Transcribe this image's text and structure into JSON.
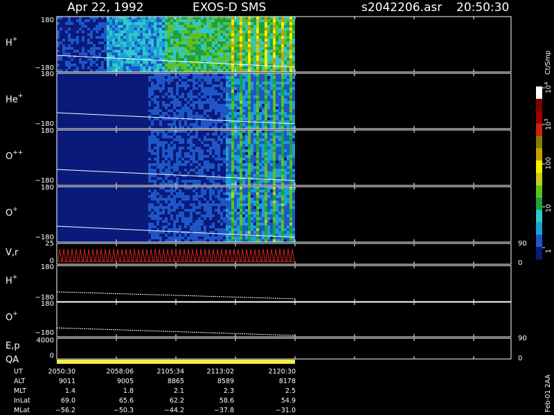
{
  "header": {
    "date": "Apr 22, 1992",
    "instrument": "EXOS-D SMS",
    "file": "s2042206.asr",
    "time": "20:50:30"
  },
  "chart_data": {
    "type": "heatmap",
    "panels": [
      {
        "label": "H",
        "sup": "+",
        "y_top": "180",
        "y_bottom": "−180"
      },
      {
        "label": "He",
        "sup": "+",
        "y_top": "180",
        "y_bottom": "−180"
      },
      {
        "label": "O",
        "sup": "++",
        "y_top": "180",
        "y_bottom": "−180"
      },
      {
        "label": "O",
        "sup": "+",
        "y_top": "180",
        "y_bottom": "−180"
      },
      {
        "label": "V,r",
        "sup": "",
        "y_top": "25",
        "y_bottom": "0",
        "right_top": "90",
        "right_bottom": "0"
      },
      {
        "label": "H",
        "sup": "+",
        "y_top": "180",
        "y_bottom": "−180"
      },
      {
        "label": "O",
        "sup": "+",
        "y_top": "180",
        "y_bottom": "−180"
      },
      {
        "label": "E,p",
        "sup": "",
        "y_top": "4000",
        "y_bottom": "0",
        "right_top": "90",
        "right_bottom": "0"
      },
      {
        "label": "QA",
        "sup": "",
        "y_top": "",
        "y_bottom": ""
      }
    ],
    "colorbar": {
      "unit": "Ct/Smp",
      "ticks": [
        {
          "base": "10",
          "exp": "4",
          "value": 10000
        },
        {
          "base": "10",
          "exp": "3",
          "value": 1000
        },
        {
          "base": "100",
          "exp": "",
          "value": 100
        },
        {
          "base": "10",
          "exp": "",
          "value": 10
        },
        {
          "base": "1",
          "exp": "",
          "value": 1
        }
      ],
      "colors": [
        "#0a1a7a",
        "#1e56c8",
        "#18a0d8",
        "#30c8c8",
        "#20a040",
        "#60c020",
        "#c0d020",
        "#f0f000",
        "#c8a000",
        "#808000",
        "#d02010",
        "#a00000",
        "#800000",
        "#ffffff"
      ]
    },
    "footer": {
      "rows": [
        {
          "label": "UT",
          "values": [
            "2050:30",
            "2058:06",
            "2105:34",
            "2113:02",
            "2120:30"
          ]
        },
        {
          "label": "ALT",
          "values": [
            "9011",
            "9005",
            "8865",
            "8589",
            "8178"
          ]
        },
        {
          "label": "MLT",
          "values": [
            "1.4",
            "1.8",
            "2.1",
            "2.3",
            "2.5"
          ]
        },
        {
          "label": "InLat",
          "values": [
            "69.0",
            "65.6",
            "62.2",
            "58.6",
            "54.9"
          ]
        },
        {
          "label": "MLat",
          "values": [
            "−56.2",
            "−50.3",
            "−44.2",
            "−37.8",
            "−31.0"
          ]
        }
      ]
    },
    "side_label": "Feb-01 2AA"
  }
}
